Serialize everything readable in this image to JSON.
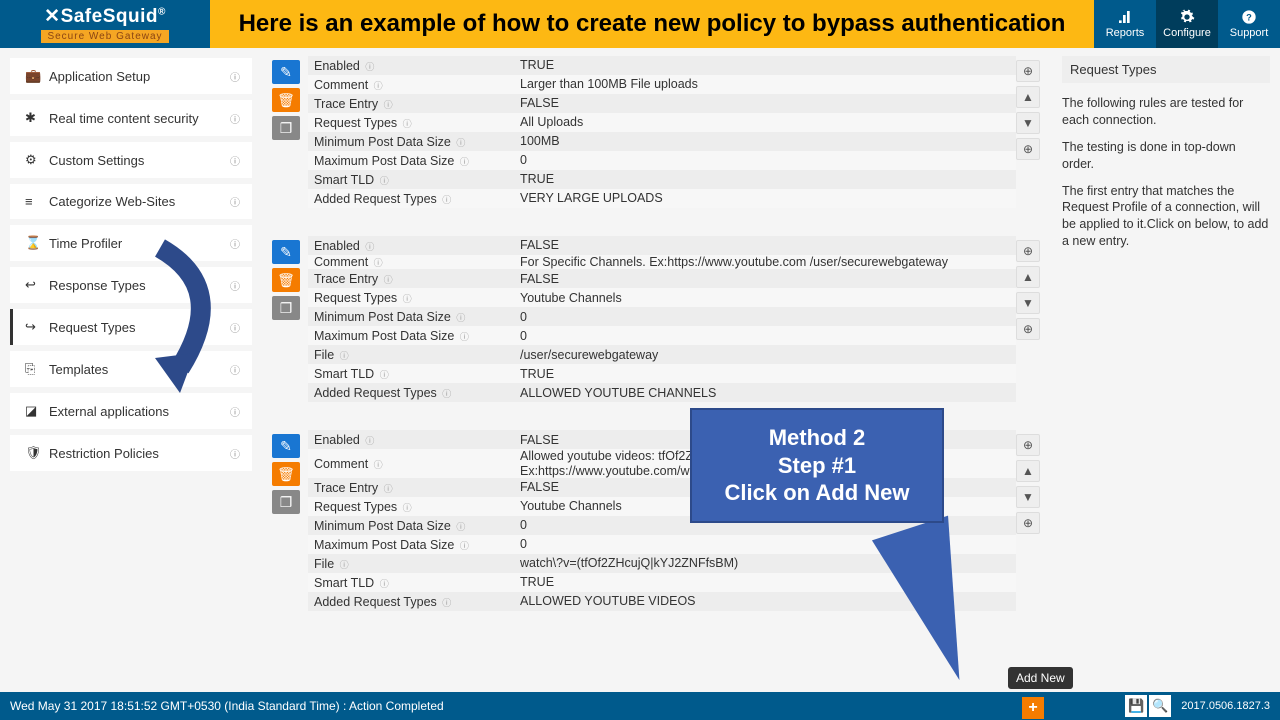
{
  "logo": {
    "name": "SafeSquid",
    "tagline": "Secure Web Gateway"
  },
  "title": "Here is an example of how to create new policy to bypass authentication",
  "nav": [
    {
      "label": "Reports"
    },
    {
      "label": "Configure"
    },
    {
      "label": "Support"
    }
  ],
  "sidebar": [
    {
      "icon": "💼",
      "label": "Application Setup"
    },
    {
      "icon": "✱",
      "label": "Real time content security"
    },
    {
      "icon": "⚙",
      "label": "Custom Settings"
    },
    {
      "icon": "≡",
      "label": "Categorize Web-Sites"
    },
    {
      "icon": "⌛",
      "label": "Time Profiler"
    },
    {
      "icon": "↩",
      "label": "Response Types"
    },
    {
      "icon": "↪",
      "label": "Request Types"
    },
    {
      "icon": "⎘",
      "label": "Templates"
    },
    {
      "icon": "◪",
      "label": "External applications"
    },
    {
      "icon": "🛡",
      "label": "Restriction Policies"
    }
  ],
  "policies": [
    {
      "rows": [
        {
          "label": "Enabled",
          "value": "TRUE"
        },
        {
          "label": "Comment",
          "value": "Larger than 100MB File uploads"
        },
        {
          "label": "Trace Entry",
          "value": "FALSE"
        },
        {
          "label": "Request Types",
          "value": "All Uploads"
        },
        {
          "label": "Minimum Post Data Size",
          "value": "100MB"
        },
        {
          "label": "Maximum Post Data Size",
          "value": "0"
        },
        {
          "label": "Smart TLD",
          "value": "TRUE"
        },
        {
          "label": "Added Request Types",
          "value": "VERY LARGE UPLOADS"
        }
      ]
    },
    {
      "rows": [
        {
          "label": "Enabled",
          "value": "FALSE"
        },
        {
          "label": "Comment",
          "value": "For Specific Channels. Ex:https://www.youtube.com /user/securewebgateway"
        },
        {
          "label": "Trace Entry",
          "value": "FALSE"
        },
        {
          "label": "Request Types",
          "value": "Youtube Channels"
        },
        {
          "label": "Minimum Post Data Size",
          "value": "0"
        },
        {
          "label": "Maximum Post Data Size",
          "value": "0"
        },
        {
          "label": "File",
          "value": "/user/securewebgateway"
        },
        {
          "label": "Smart TLD",
          "value": "TRUE"
        },
        {
          "label": "Added Request Types",
          "value": "ALLOWED YOUTUBE CHANNELS"
        }
      ]
    },
    {
      "rows": [
        {
          "label": "Enabled",
          "value": "FALSE"
        },
        {
          "label": "Comment",
          "value": "Allowed youtube videos: tfOf2ZHcujQ, and kYJ2ZNFfsBM Ex:https://www.youtube.com/watch?v=tfOf2ZHcujQ"
        },
        {
          "label": "Trace Entry",
          "value": "FALSE"
        },
        {
          "label": "Request Types",
          "value": "Youtube Channels"
        },
        {
          "label": "Minimum Post Data Size",
          "value": "0"
        },
        {
          "label": "Maximum Post Data Size",
          "value": "0"
        },
        {
          "label": "File",
          "value": "watch\\?v=(tfOf2ZHcujQ|kYJ2ZNFfsBM)"
        },
        {
          "label": "Smart TLD",
          "value": "TRUE"
        },
        {
          "label": "Added Request Types",
          "value": "ALLOWED YOUTUBE VIDEOS"
        }
      ]
    }
  ],
  "rightPanel": {
    "title": "Request Types",
    "p1": "The following rules are tested for each connection.",
    "p2": "The testing is done in top-down order.",
    "p3": "The first entry that matches the Request Profile of a connection, will be applied to it.Click on below, to add a new entry."
  },
  "callout": {
    "l1": "Method 2",
    "l2": "Step #1",
    "l3": "Click on Add New"
  },
  "tooltip": "Add New",
  "footer": {
    "status": "Wed May 31 2017 18:51:52 GMT+0530 (India Standard Time) : Action Completed",
    "version": "2017.0506.1827.3"
  }
}
